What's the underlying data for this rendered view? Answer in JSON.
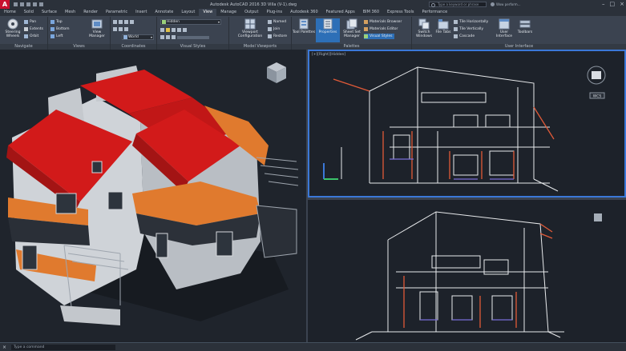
{
  "app": {
    "logo_letter": "A",
    "title": "Autodesk AutoCAD 2016   3D Villa (V-1).dwg",
    "search_placeholder": "Type a keyword or phrase",
    "user": "Wow perform...",
    "window_controls": [
      "–",
      "□",
      "×"
    ]
  },
  "tabs": [
    "Home",
    "Solid",
    "Surface",
    "Mesh",
    "Render",
    "Parametric",
    "Insert",
    "Annotate",
    "Layout",
    "View",
    "Manage",
    "Output",
    "Plug-ins",
    "Autodesk 360",
    "Featured Apps",
    "BIM 360",
    "Express Tools",
    "Performance"
  ],
  "active_tab": "View",
  "ribbon": {
    "navigate": {
      "title": "Navigate",
      "steering_label": "Steering Wheels",
      "pan": "Pan",
      "extents": "Extents",
      "orbit": "Orbit"
    },
    "views": {
      "title": "Views",
      "items": [
        "Top",
        "Bottom",
        "Left"
      ],
      "view_manager": "View Manager"
    },
    "coordinates": {
      "title": "Coordinates",
      "world": "World"
    },
    "visual_styles": {
      "title": "Visual Styles",
      "style": "Hidden"
    },
    "model_viewports": {
      "title": "Model Viewports",
      "viewport_config": "Viewport Configuration",
      "named": "Named",
      "join": "Join",
      "restore": "Restore"
    },
    "palettes": {
      "title": "Palettes",
      "tool_palettes": "Tool Palettes",
      "properties": "Properties",
      "sheet_set": "Sheet Set Manager",
      "materials_browser": "Materials Browser",
      "materials_editor": "Materials Editor",
      "visual_styles": "Visual Styles"
    },
    "user_interface": {
      "title": "User Interface",
      "switch_windows": "Switch Windows",
      "file_tabs": "File Tabs",
      "tile_h": "Tile Horizontally",
      "tile_v": "Tile Vertically",
      "cascade": "Cascade",
      "ui": "User Interface",
      "toolbars": "Toolbars"
    }
  },
  "viewports": {
    "top_right_label": "[+][Right][Hidden]",
    "wcs": "WCS"
  },
  "command": {
    "placeholder": "Type a command"
  },
  "colors": {
    "roof": "#d21a1a",
    "viewport_highlight": "#3b78d8",
    "ribbon_bg": "#3b4350"
  }
}
